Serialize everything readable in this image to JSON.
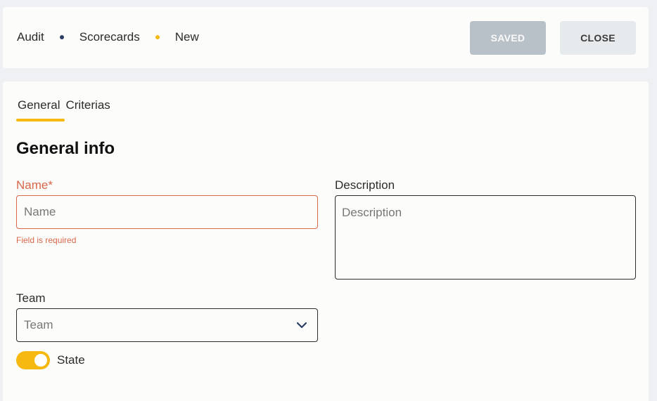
{
  "breadcrumb": {
    "items": [
      "Audit",
      "Scorecards",
      "New"
    ],
    "dot_colors": [
      "#2b3d63",
      "#f5b912"
    ]
  },
  "toolbar": {
    "saved_label": "SAVED",
    "close_label": "CLOSE"
  },
  "tabs": [
    {
      "label": "General",
      "active": true
    },
    {
      "label": "Criterias",
      "active": false
    }
  ],
  "section": {
    "title": "General info"
  },
  "form": {
    "name": {
      "label": "Name*",
      "placeholder": "Name",
      "value": "",
      "error": "Field is required"
    },
    "description": {
      "label": "Description",
      "placeholder": "Description",
      "value": ""
    },
    "team": {
      "label": "Team",
      "placeholder": "Team",
      "value": ""
    },
    "state": {
      "label": "State",
      "on": true
    }
  },
  "colors": {
    "accent": "#f5b912",
    "error": "#d9674a",
    "saved_button": "#b9c1c8",
    "close_button": "#e7eaec"
  },
  "icons": {
    "team_select": "chevron-down-icon"
  }
}
